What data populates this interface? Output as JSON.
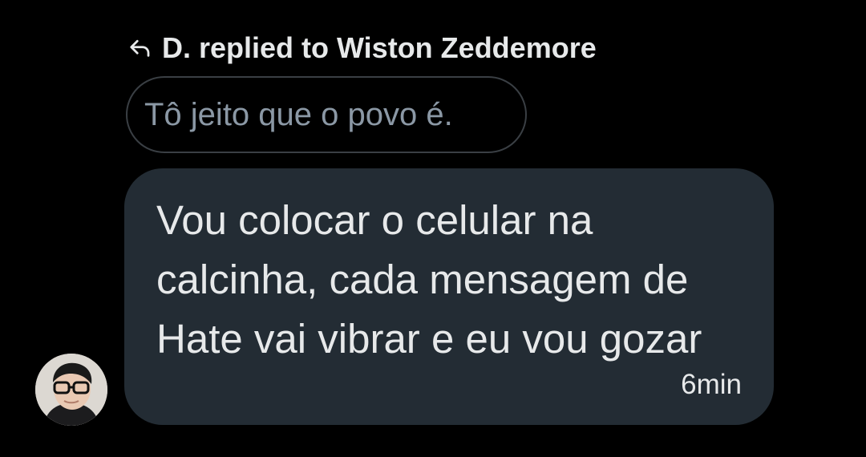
{
  "reply_header": {
    "icon": "reply-arrow-icon",
    "text": "D. replied to Wiston Zeddemore"
  },
  "quoted_message": {
    "text": "Tô jeito que o povo é."
  },
  "message": {
    "lines": [
      "Vou colocar o celular na",
      "calcinha, cada mensagem de",
      "Hate vai vibrar e eu vou gozar"
    ],
    "timestamp": "6min"
  },
  "avatar": {
    "icon": "user-avatar-photo"
  },
  "colors": {
    "background": "#000000",
    "bubble": "#232c34",
    "quoted_border": "#3a3f44",
    "quoted_text": "#8b98a5",
    "text": "#e7e9ea"
  }
}
